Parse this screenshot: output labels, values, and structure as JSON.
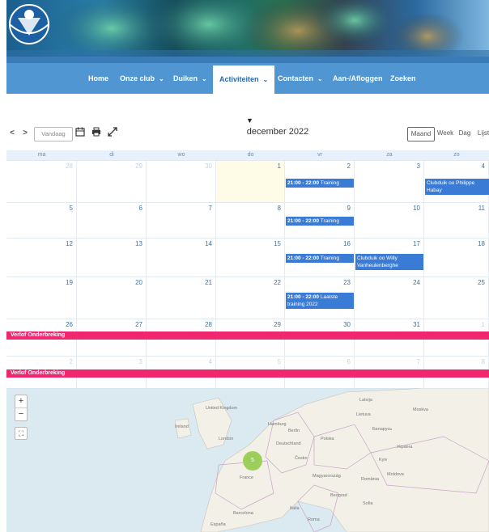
{
  "nav": {
    "items": [
      {
        "label": "Home"
      },
      {
        "label": "Onze club",
        "dropdown": true
      },
      {
        "label": "Duiken",
        "dropdown": true
      },
      {
        "label": "Activiteiten",
        "dropdown": true,
        "active": true
      },
      {
        "label": "Contacten",
        "dropdown": true
      },
      {
        "label": "Aan-/Afloggen"
      },
      {
        "label": "Zoeken"
      }
    ]
  },
  "toolbar": {
    "prev": "<",
    "next": ">",
    "today": "Vandaag",
    "title": "december 2022",
    "views": [
      "Maand",
      "Week",
      "Dag",
      "Lijst"
    ],
    "active_view": "Maand"
  },
  "calendar": {
    "days_of_week": [
      "ma",
      "di",
      "wo",
      "do",
      "vr",
      "za",
      "zo"
    ],
    "weeks": [
      [
        "28",
        "29",
        "30",
        "1",
        "2",
        "3",
        "4"
      ],
      [
        "5",
        "6",
        "7",
        "8",
        "9",
        "10",
        "11"
      ],
      [
        "12",
        "13",
        "14",
        "15",
        "16",
        "17",
        "18"
      ],
      [
        "19",
        "20",
        "21",
        "22",
        "23",
        "24",
        "25"
      ],
      [
        "26",
        "27",
        "28",
        "29",
        "30",
        "31",
        "1"
      ],
      [
        "2",
        "3",
        "4",
        "5",
        "6",
        "7",
        "8"
      ]
    ],
    "events": {
      "training_1": {
        "time": "21:00 - 22:00",
        "title": "Training"
      },
      "club_philippe": {
        "title": "Clubduik oo Philippe Habay"
      },
      "training_2": {
        "time": "21:00 - 22:00",
        "title": "Training"
      },
      "training_3": {
        "time": "21:00 - 22:00",
        "title": "Training"
      },
      "club_willy": {
        "title": "Clubduik oo Willy Vanheulenberghe"
      },
      "training_4": {
        "time": "21:00 - 22:00",
        "title": "Laatste training 2022"
      }
    },
    "bars": [
      "Verlof Onderbreking",
      "Verlof Onderbreking"
    ]
  },
  "map": {
    "zoom_in": "+",
    "zoom_out": "−",
    "cluster_count": "5",
    "labels": [
      "United Kingdom",
      "Ireland",
      "London",
      "Hamburg",
      "Berlin",
      "Deutschland",
      "Polska",
      "Česko",
      "France",
      "Kyiv",
      "Moskva",
      "Magyarország",
      "România",
      "Barcelona",
      "España",
      "Roma",
      "Italia",
      "Latvija",
      "Lietuva",
      "Беларусь",
      "Україна",
      "Moldova",
      "Sofia",
      "Beograd"
    ]
  },
  "colors": {
    "nav": "#5096d2",
    "event": "#3a7bd5",
    "bar": "#f0266f",
    "today": "#fefbe6"
  }
}
